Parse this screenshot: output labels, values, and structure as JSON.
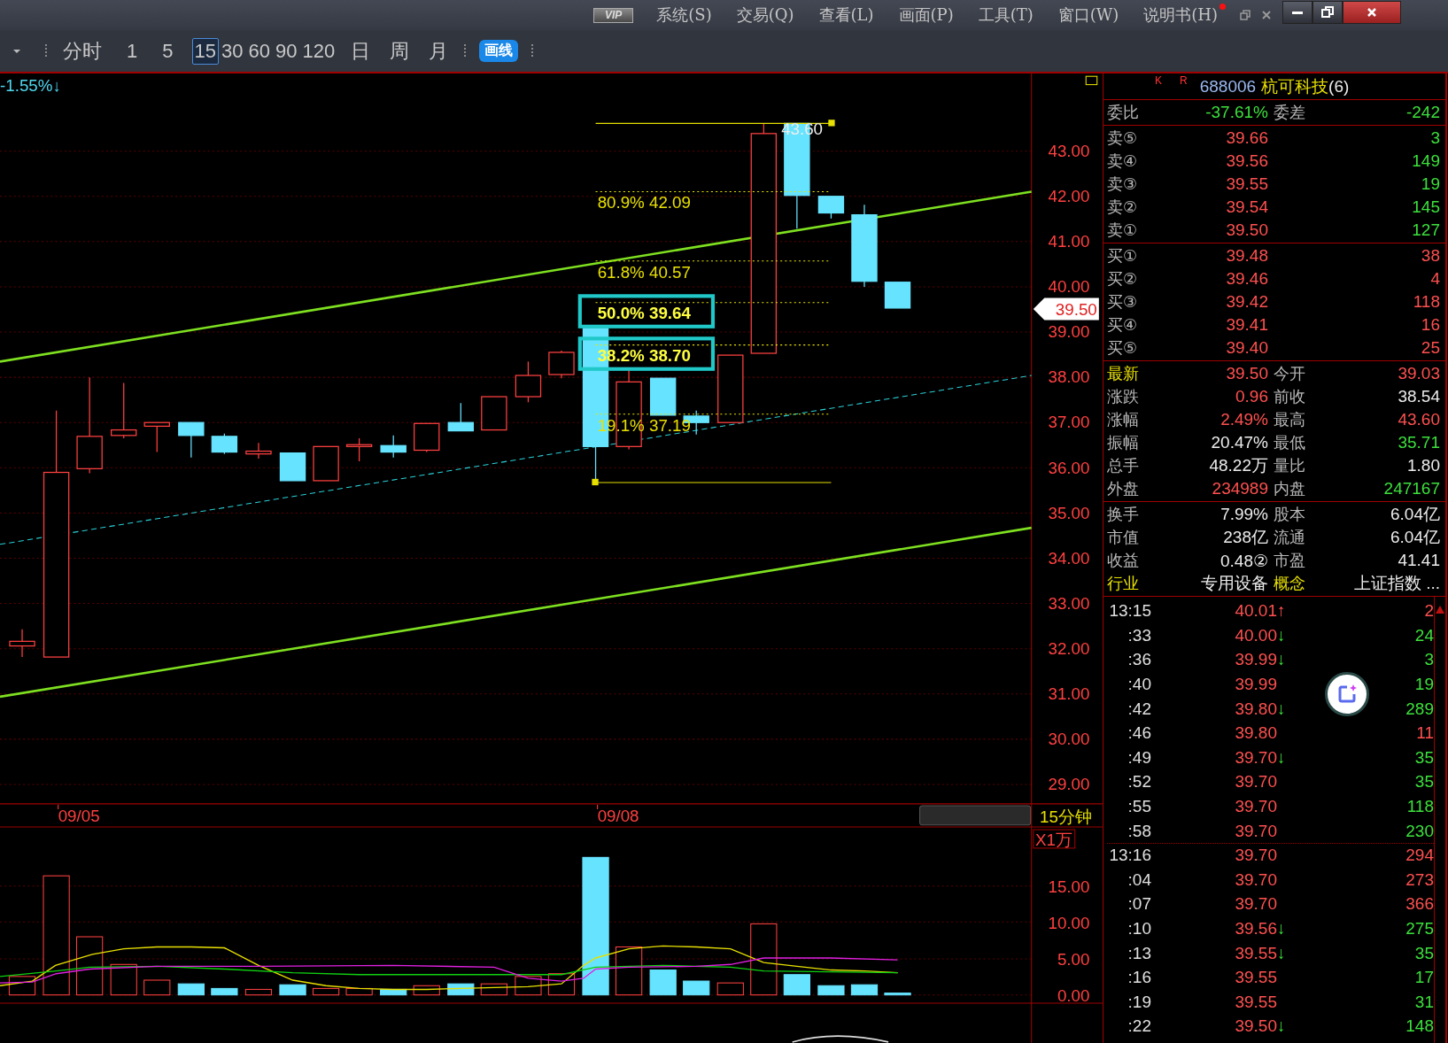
{
  "menu_bar": {
    "vip_badge": "VIP",
    "menus": [
      "系统(S)",
      "交易(Q)",
      "查看(L)",
      "画面(P)",
      "工具(T)",
      "窗口(W)",
      "说明书(H)"
    ]
  },
  "toolbar": {
    "periods": [
      {
        "label": "分时",
        "selected": false
      },
      {
        "label": "1",
        "selected": false
      },
      {
        "label": "5",
        "selected": false
      },
      {
        "label": "15",
        "selected": true
      },
      {
        "label": "30",
        "selected": false
      },
      {
        "label": "60",
        "selected": false
      },
      {
        "label": "90",
        "selected": false
      },
      {
        "label": "120",
        "selected": false
      },
      {
        "label": "日",
        "selected": false
      },
      {
        "label": "周",
        "selected": false
      },
      {
        "label": "月",
        "selected": false
      }
    ],
    "draw_button": "画线"
  },
  "chart": {
    "change": "-1.55%↓",
    "high_label": "43.60",
    "price_labels": [
      "43.00",
      "42.00",
      "41.00",
      "40.00",
      "39.00",
      "38.00",
      "37.00",
      "36.00",
      "35.00",
      "34.00",
      "33.00",
      "32.00",
      "31.00",
      "30.00",
      "29.00"
    ],
    "current_price": "39.50",
    "fib_levels": [
      {
        "label": "80.9% 42.09",
        "highlighted": false
      },
      {
        "label": "61.8% 40.57",
        "highlighted": false
      },
      {
        "label": "50.0% 39.64",
        "highlighted": true
      },
      {
        "label": "38.2% 38.70",
        "highlighted": true
      },
      {
        "label": "19.1% 37.19",
        "highlighted": false
      }
    ],
    "dates": [
      "09/05",
      "09/08"
    ],
    "period": "15分钟",
    "volume_unit": "X1万",
    "volume_labels": [
      "15.00",
      "10.00",
      "5.00",
      "0.00"
    ]
  },
  "quote": {
    "marks": [
      "K",
      "R"
    ],
    "code": "688006",
    "name": "杭可科技",
    "count": "(6)",
    "ratio": {
      "label": "委比",
      "value": "-37.61%",
      "rising": false,
      "falling": true,
      "label2": "委差",
      "value2": "-242",
      "rising2": false,
      "falling2": true
    },
    "asks": [
      {
        "label": "卖⑤",
        "price": "39.66",
        "volume": "3",
        "volume_rising": false
      },
      {
        "label": "卖④",
        "price": "39.56",
        "volume": "149",
        "volume_rising": false
      },
      {
        "label": "卖③",
        "price": "39.55",
        "volume": "19",
        "volume_rising": false
      },
      {
        "label": "卖②",
        "price": "39.54",
        "volume": "145",
        "volume_rising": false
      },
      {
        "label": "卖①",
        "price": "39.50",
        "volume": "127",
        "volume_rising": false
      }
    ],
    "bids": [
      {
        "label": "买①",
        "price": "39.48",
        "volume": "38",
        "volume_rising": true
      },
      {
        "label": "买②",
        "price": "39.46",
        "volume": "4",
        "volume_rising": true
      },
      {
        "label": "买③",
        "price": "39.42",
        "volume": "118",
        "volume_rising": true
      },
      {
        "label": "买④",
        "price": "39.41",
        "volume": "16",
        "volume_rising": true
      },
      {
        "label": "买⑤",
        "price": "39.40",
        "volume": "25",
        "volume_rising": true
      }
    ],
    "stats": [
      {
        "label": "最新",
        "highlighted": true,
        "value": "39.50",
        "rising": true,
        "falling": false
      },
      {
        "label": "今开",
        "highlighted": false,
        "value": "39.03",
        "rising": true,
        "falling": false
      },
      {
        "label": "涨跌",
        "highlighted": false,
        "value": "0.96",
        "rising": true,
        "falling": false
      },
      {
        "label": "前收",
        "highlighted": false,
        "value": "38.54",
        "rising": false,
        "falling": false
      },
      {
        "label": "涨幅",
        "highlighted": false,
        "value": "2.49%",
        "rising": true,
        "falling": false
      },
      {
        "label": "最高",
        "highlighted": false,
        "value": "43.60",
        "rising": true,
        "falling": false
      },
      {
        "label": "振幅",
        "highlighted": false,
        "value": "20.47%",
        "rising": false,
        "falling": false
      },
      {
        "label": "最低",
        "highlighted": false,
        "value": "35.71",
        "rising": false,
        "falling": true
      },
      {
        "label": "总手",
        "highlighted": false,
        "value": "48.22万",
        "rising": false,
        "falling": false
      },
      {
        "label": "量比",
        "highlighted": false,
        "value": "1.80",
        "rising": false,
        "falling": false
      },
      {
        "label": "外盘",
        "highlighted": false,
        "value": "234989",
        "rising": true,
        "falling": false
      },
      {
        "label": "内盘",
        "highlighted": false,
        "value": "247167",
        "rising": false,
        "falling": true
      }
    ],
    "stats2": [
      {
        "label": "换手",
        "highlighted": false,
        "value": "7.99%",
        "rising": false,
        "falling": false
      },
      {
        "label": "股本",
        "highlighted": false,
        "value": "6.04亿",
        "rising": false,
        "falling": false
      },
      {
        "label": "市值",
        "highlighted": false,
        "value": "238亿",
        "rising": false,
        "falling": false
      },
      {
        "label": "流通",
        "highlighted": false,
        "value": "6.04亿",
        "rising": false,
        "falling": false
      },
      {
        "label": "收益",
        "highlighted": false,
        "value": "0.48②",
        "rising": false,
        "falling": false
      },
      {
        "label": "市盈",
        "highlighted": false,
        "value": "41.41",
        "rising": false,
        "falling": false
      },
      {
        "label": "行业",
        "highlighted": true,
        "value": "专用设备",
        "rising": false,
        "falling": false
      },
      {
        "label": "概念",
        "highlighted": true,
        "value": "上证指数 ...",
        "rising": false,
        "falling": false
      }
    ],
    "ticks": [
      {
        "time": "13:15",
        "price": "40.01",
        "arrow": "↑",
        "arrow_rising": true,
        "volume": "2",
        "volume_rising": true,
        "separator_before": false
      },
      {
        "time": ":33",
        "price": "40.00",
        "arrow": "↓",
        "arrow_rising": false,
        "volume": "24",
        "volume_rising": false,
        "separator_before": false
      },
      {
        "time": ":36",
        "price": "39.99",
        "arrow": "↓",
        "arrow_rising": false,
        "volume": "3",
        "volume_rising": false,
        "separator_before": false
      },
      {
        "time": ":40",
        "price": "39.99",
        "volume": "19",
        "volume_rising": false,
        "separator_before": false
      },
      {
        "time": ":42",
        "price": "39.80",
        "arrow": "↓",
        "arrow_rising": false,
        "volume": "289",
        "volume_rising": false,
        "separator_before": false
      },
      {
        "time": ":46",
        "price": "39.80",
        "volume": "11",
        "volume_rising": true,
        "separator_before": false
      },
      {
        "time": ":49",
        "price": "39.70",
        "arrow": "↓",
        "arrow_rising": false,
        "volume": "35",
        "volume_rising": false,
        "separator_before": false
      },
      {
        "time": ":52",
        "price": "39.70",
        "volume": "35",
        "volume_rising": false,
        "separator_before": false
      },
      {
        "time": ":55",
        "price": "39.70",
        "volume": "118",
        "volume_rising": false,
        "separator_before": false
      },
      {
        "time": ":58",
        "price": "39.70",
        "volume": "230",
        "volume_rising": false,
        "separator_before": false
      },
      {
        "time": "13:16",
        "price": "39.70",
        "volume": "294",
        "volume_rising": true,
        "separator_before": true
      },
      {
        "time": ":04",
        "price": "39.70",
        "volume": "273",
        "volume_rising": true,
        "separator_before": false
      },
      {
        "time": ":07",
        "price": "39.70",
        "volume": "366",
        "volume_rising": true,
        "separator_before": false
      },
      {
        "time": ":10",
        "price": "39.56",
        "arrow": "↓",
        "arrow_rising": false,
        "volume": "275",
        "volume_rising": false,
        "separator_before": false
      },
      {
        "time": ":13",
        "price": "39.55",
        "arrow": "↓",
        "arrow_rising": false,
        "volume": "35",
        "volume_rising": false,
        "separator_before": false
      },
      {
        "time": ":16",
        "price": "39.55",
        "volume": "17",
        "volume_rising": false,
        "separator_before": false
      },
      {
        "time": ":19",
        "price": "39.55",
        "volume": "31",
        "volume_rising": false,
        "separator_before": false
      },
      {
        "time": ":22",
        "price": "39.50",
        "arrow": "↓",
        "arrow_rising": false,
        "volume": "148",
        "volume_rising": false,
        "separator_before": false
      }
    ]
  }
}
